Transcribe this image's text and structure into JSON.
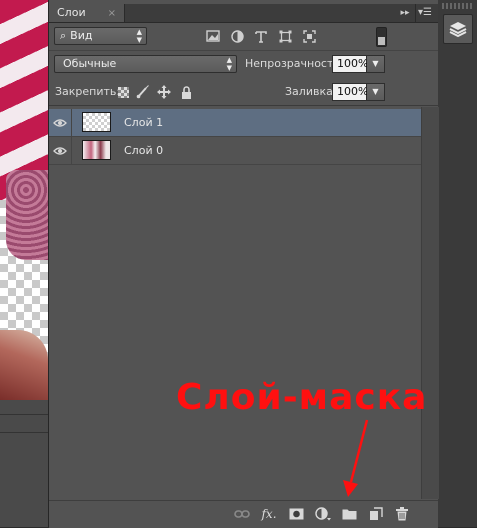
{
  "panel": {
    "tab_label": "Слои",
    "tab_close": "×",
    "collapse_glyph": "▸▸",
    "menu_glyph": "▾☰"
  },
  "filter": {
    "kind_label": "Вид",
    "search_glyph": "⌕"
  },
  "blend": {
    "mode": "Обычные",
    "opacity_label": "Непрозрачность:",
    "opacity_value": "100%"
  },
  "lock": {
    "label": "Закрепить:",
    "fill_label": "Заливка:",
    "fill_value": "100%"
  },
  "layers": [
    {
      "name": "Слой 1",
      "selected": true,
      "thumbnail": "transparent"
    },
    {
      "name": "Слой 0",
      "selected": false,
      "thumbnail": "photo"
    }
  ],
  "annotation": {
    "text": "Слой-маска",
    "color": "#ff1010"
  },
  "footer": {
    "fx_label": "fx."
  },
  "colors": {
    "panel_bg": "#535353",
    "selected_row": "#5e6e82",
    "annotation_red": "#ff1010"
  }
}
